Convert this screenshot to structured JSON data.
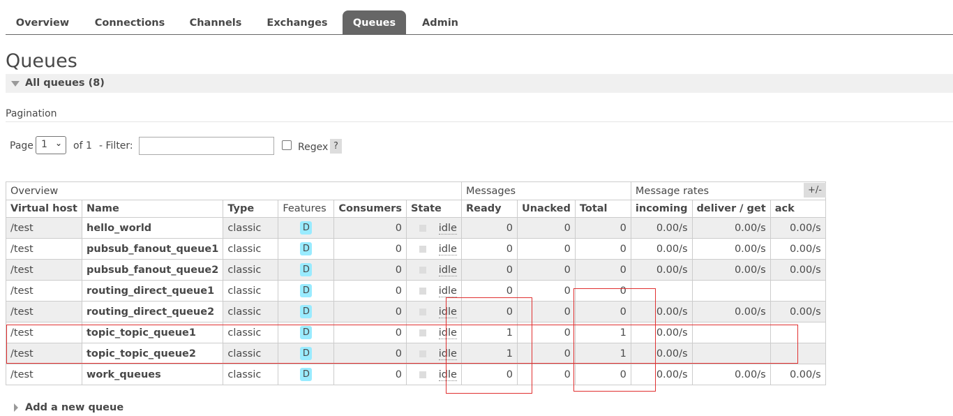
{
  "nav": {
    "tabs": [
      {
        "label": "Overview",
        "active": false
      },
      {
        "label": "Connections",
        "active": false
      },
      {
        "label": "Channels",
        "active": false
      },
      {
        "label": "Exchanges",
        "active": false
      },
      {
        "label": "Queues",
        "active": true
      },
      {
        "label": "Admin",
        "active": false
      }
    ]
  },
  "page": {
    "title": "Queues",
    "section_label": "All queues (8)"
  },
  "pagination": {
    "heading": "Pagination",
    "page_label": "Page",
    "page_value": "1",
    "of_label": "of 1",
    "filter_label": "- Filter:",
    "filter_value": "",
    "regex_label": "Regex",
    "regex_checked": false,
    "help_label": "?"
  },
  "table": {
    "groups": [
      "Overview",
      "Messages",
      "Message rates"
    ],
    "columns": [
      "Virtual host",
      "Name",
      "Type",
      "Features",
      "Consumers",
      "State",
      "Ready",
      "Unacked",
      "Total",
      "incoming",
      "deliver / get",
      "ack"
    ],
    "toggle_label": "+/-",
    "rows": [
      {
        "vhost": "/test",
        "name": "hello_world",
        "type": "classic",
        "feature": "D",
        "consumers": "0",
        "state": "idle",
        "ready": "0",
        "unacked": "0",
        "total": "0",
        "incoming": "0.00/s",
        "deliver": "0.00/s",
        "ack": "0.00/s"
      },
      {
        "vhost": "/test",
        "name": "pubsub_fanout_queue1",
        "type": "classic",
        "feature": "D",
        "consumers": "0",
        "state": "idle",
        "ready": "0",
        "unacked": "0",
        "total": "0",
        "incoming": "0.00/s",
        "deliver": "0.00/s",
        "ack": "0.00/s"
      },
      {
        "vhost": "/test",
        "name": "pubsub_fanout_queue2",
        "type": "classic",
        "feature": "D",
        "consumers": "0",
        "state": "idle",
        "ready": "0",
        "unacked": "0",
        "total": "0",
        "incoming": "0.00/s",
        "deliver": "0.00/s",
        "ack": "0.00/s"
      },
      {
        "vhost": "/test",
        "name": "routing_direct_queue1",
        "type": "classic",
        "feature": "D",
        "consumers": "0",
        "state": "idle",
        "ready": "0",
        "unacked": "0",
        "total": "0",
        "incoming": "",
        "deliver": "",
        "ack": ""
      },
      {
        "vhost": "/test",
        "name": "routing_direct_queue2",
        "type": "classic",
        "feature": "D",
        "consumers": "0",
        "state": "idle",
        "ready": "0",
        "unacked": "0",
        "total": "0",
        "incoming": "0.00/s",
        "deliver": "0.00/s",
        "ack": "0.00/s"
      },
      {
        "vhost": "/test",
        "name": "topic_topic_queue1",
        "type": "classic",
        "feature": "D",
        "consumers": "0",
        "state": "idle",
        "ready": "1",
        "unacked": "0",
        "total": "1",
        "incoming": "0.00/s",
        "deliver": "",
        "ack": ""
      },
      {
        "vhost": "/test",
        "name": "topic_topic_queue2",
        "type": "classic",
        "feature": "D",
        "consumers": "0",
        "state": "idle",
        "ready": "1",
        "unacked": "0",
        "total": "1",
        "incoming": "0.00/s",
        "deliver": "",
        "ack": ""
      },
      {
        "vhost": "/test",
        "name": "work_queues",
        "type": "classic",
        "feature": "D",
        "consumers": "0",
        "state": "idle",
        "ready": "0",
        "unacked": "0",
        "total": "0",
        "incoming": "0.00/s",
        "deliver": "0.00/s",
        "ack": "0.00/s"
      }
    ]
  },
  "add_queue": {
    "label": "Add a new queue"
  },
  "colors": {
    "accent_tab": "#666666",
    "badge": "#99ebff",
    "annotation": "#e03030"
  }
}
